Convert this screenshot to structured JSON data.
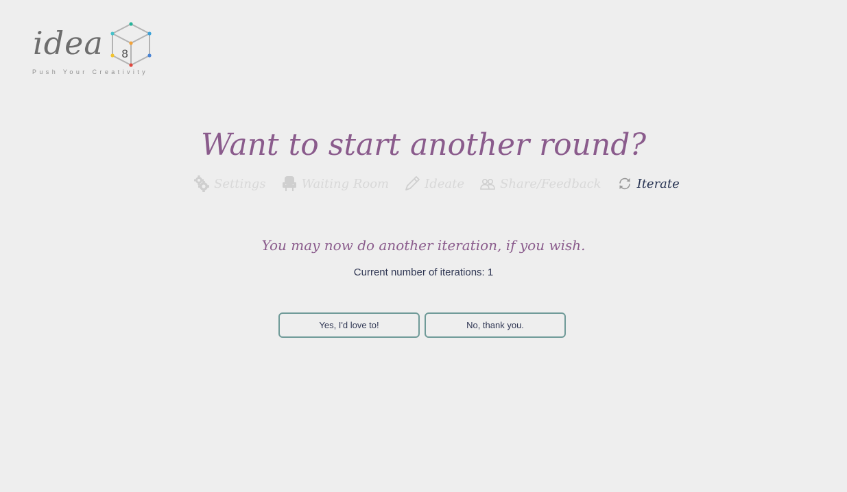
{
  "logo": {
    "word": "idea",
    "cube_digit": "8",
    "tagline": "Push Your Creativity"
  },
  "headline": "Want to start another round?",
  "steps": [
    {
      "label": "Settings",
      "icon": "gear-icon",
      "state": "inactive"
    },
    {
      "label": "Waiting Room",
      "icon": "chair-icon",
      "state": "inactive"
    },
    {
      "label": "Ideate",
      "icon": "pencil-icon",
      "state": "inactive"
    },
    {
      "label": "Share/Feedback",
      "icon": "people-icon",
      "state": "inactive"
    },
    {
      "label": "Iterate",
      "icon": "refresh-icon",
      "state": "active"
    }
  ],
  "message": "You may now do another iteration, if you wish.",
  "iterations_text": "Current number of iterations: 1",
  "buttons": {
    "yes_label": "Yes, I'd love to!",
    "no_label": "No, thank you."
  },
  "colors": {
    "background": "#eeeeee",
    "headline": "#8a5b8c",
    "text_dark": "#2e3552",
    "inactive_step": "#d8d8d8",
    "button_border": "#6f9a98"
  }
}
